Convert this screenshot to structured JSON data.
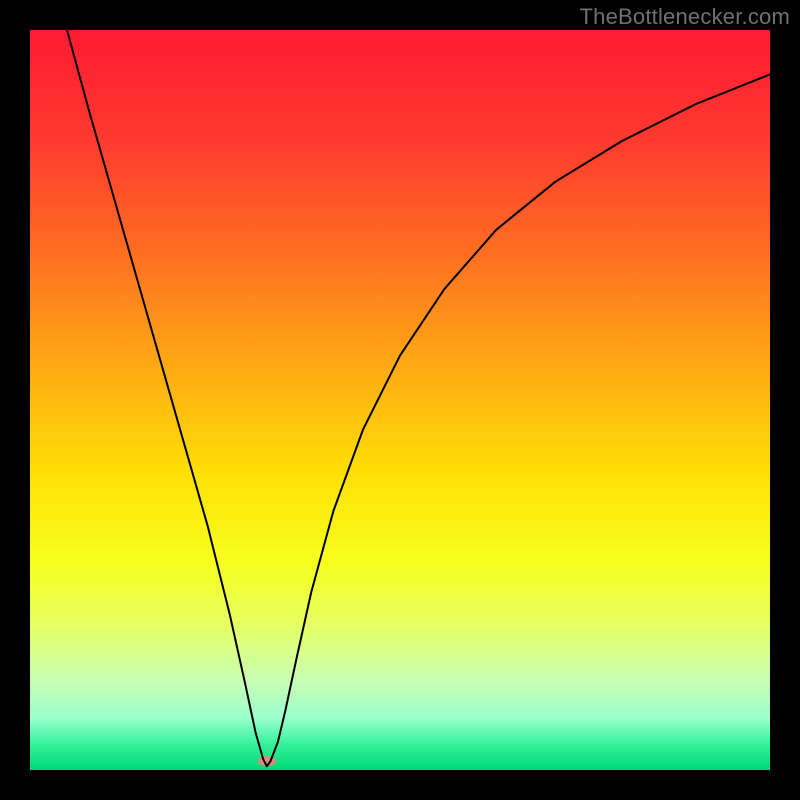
{
  "watermark": "TheBottlenecker.com",
  "chart_data": {
    "type": "line",
    "title": "",
    "xlabel": "",
    "ylabel": "",
    "xlim": [
      0,
      100
    ],
    "ylim": [
      0,
      100
    ],
    "grid": false,
    "legend": false,
    "background_gradient": {
      "stops": [
        {
          "offset": 0.0,
          "color": "#ff1a33"
        },
        {
          "offset": 0.15,
          "color": "#ff3a2e"
        },
        {
          "offset": 0.3,
          "color": "#ff6e22"
        },
        {
          "offset": 0.45,
          "color": "#ffa814"
        },
        {
          "offset": 0.6,
          "color": "#ffe006"
        },
        {
          "offset": 0.72,
          "color": "#f7ff1e"
        },
        {
          "offset": 0.8,
          "color": "#e7ff60"
        },
        {
          "offset": 0.88,
          "color": "#c8ffb4"
        },
        {
          "offset": 0.93,
          "color": "#9bffcf"
        },
        {
          "offset": 0.965,
          "color": "#35f29a"
        },
        {
          "offset": 1.0,
          "color": "#00d976"
        }
      ]
    },
    "series": [
      {
        "name": "bottleneck-curve",
        "stroke": "#000000",
        "stroke_width": 2,
        "x": [
          5,
          8,
          12,
          16,
          20,
          24,
          27,
          29,
          30.5,
          31.5,
          32,
          32.5,
          33.5,
          34.5,
          36,
          38,
          41,
          45,
          50,
          56,
          63,
          71,
          80,
          90,
          100
        ],
        "values": [
          100,
          89,
          75,
          61,
          47,
          33,
          21,
          12,
          5,
          1.5,
          0.5,
          1.2,
          3.8,
          8,
          15,
          24,
          35,
          46,
          56,
          65,
          73,
          79.5,
          85,
          90,
          94
        ]
      }
    ],
    "markers": [
      {
        "name": "min-marker",
        "x": 32,
        "y": 1.2,
        "color": "#e28a7a",
        "rx": 9,
        "ry": 5
      }
    ]
  }
}
